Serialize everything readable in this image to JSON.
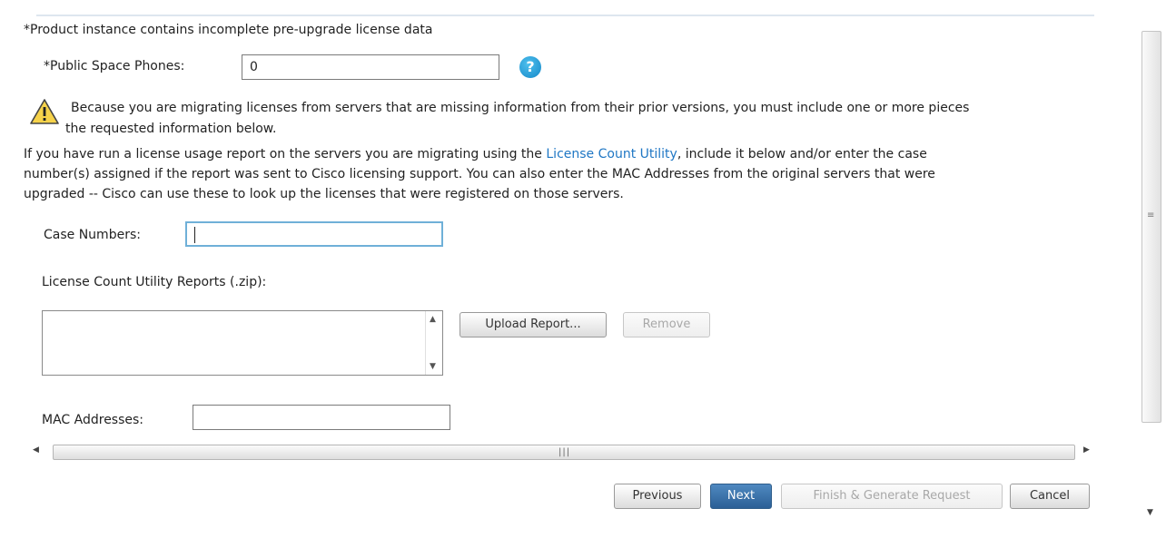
{
  "header": {
    "incomplete_notice": "*Product instance contains incomplete pre-upgrade license data"
  },
  "public_space_phones": {
    "label": "*Public Space Phones:",
    "value": "0",
    "help_glyph": "?"
  },
  "warning": {
    "icon": "warning-triangle-icon",
    "line1": "Because you are migrating licenses from servers that are missing information from their prior versions, you must include one or more pieces",
    "line2": "the requested information below."
  },
  "info": {
    "line1_prefix": "If you have run a license usage report on the servers you are migrating using the ",
    "link": "License Count Utility",
    "line1_suffix": ", include it below and/or enter the case",
    "line2": "number(s) assigned if the report was sent to Cisco licensing support. You can also enter the MAC Addresses from the original servers that were",
    "line3": "upgraded -- Cisco can use these to look up the licenses that were registered on those servers."
  },
  "case_numbers": {
    "label": "Case Numbers:",
    "value": ""
  },
  "reports": {
    "label": "License Count Utility Reports (.zip):",
    "items": [],
    "upload_label": "Upload Report...",
    "remove_label": "Remove"
  },
  "mac_addresses": {
    "label": "MAC Addresses:",
    "value": ""
  },
  "footer": {
    "previous_label": "Previous",
    "next_label": "Next",
    "finish_label": "Finish & Generate Request",
    "cancel_label": "Cancel"
  },
  "colors": {
    "link": "#1f77c4",
    "primary_button": "#2b5f96",
    "focus_border": "#6fb0d8",
    "help_icon": "#1488c8"
  }
}
